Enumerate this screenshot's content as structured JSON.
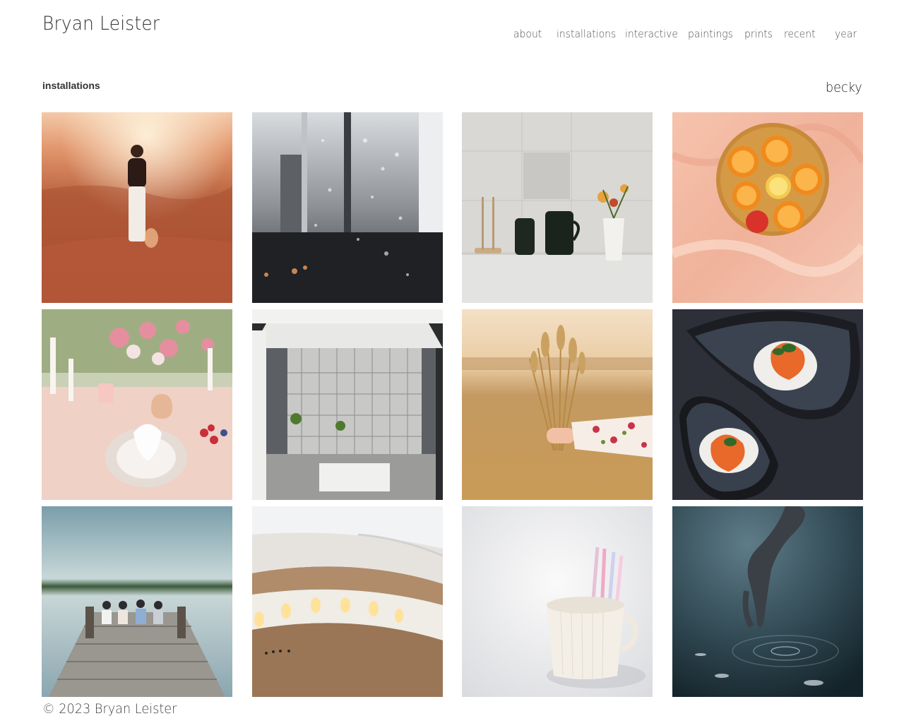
{
  "site": {
    "title": "Bryan Leister"
  },
  "nav": {
    "items": [
      {
        "label": "about"
      },
      {
        "label": "installations"
      },
      {
        "label": "interactive"
      },
      {
        "label": "paintings"
      },
      {
        "label": "prints"
      },
      {
        "label": "recent"
      },
      {
        "label": "year"
      }
    ]
  },
  "page": {
    "section_title": "installations",
    "gallery_title": "becky"
  },
  "gallery": {
    "images": [
      {
        "subject": "woman-in-desert"
      },
      {
        "subject": "rain-on-window-city"
      },
      {
        "subject": "kitchen-counter-still-life"
      },
      {
        "subject": "oranges-in-colander"
      },
      {
        "subject": "floral-table-setting"
      },
      {
        "subject": "storefront-window"
      },
      {
        "subject": "hand-holding-wheat"
      },
      {
        "subject": "sea-urchin-bowls"
      },
      {
        "subject": "friends-on-dock"
      },
      {
        "subject": "museum-rotunda"
      },
      {
        "subject": "pencils-in-cup"
      },
      {
        "subject": "hand-touching-water"
      }
    ]
  },
  "footer": {
    "copyright": "© 2023 Bryan Leister"
  }
}
